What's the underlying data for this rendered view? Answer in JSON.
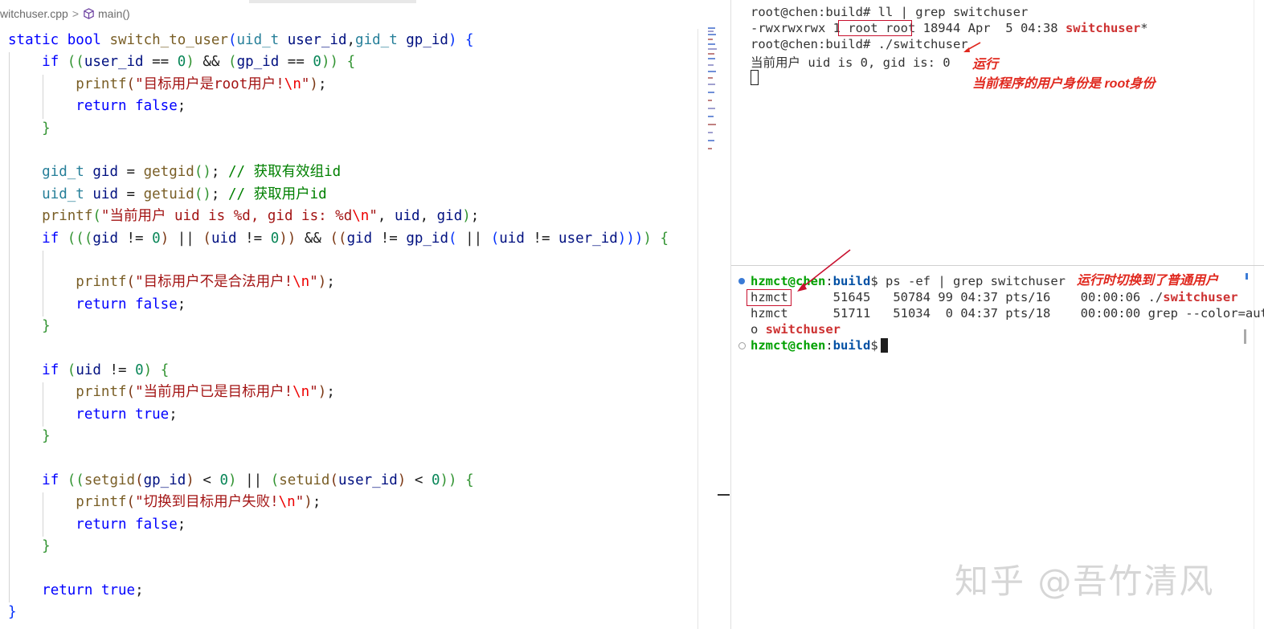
{
  "breadcrumb": {
    "file": "witchuser.cpp",
    "separator": ">",
    "symbol": "main()"
  },
  "code_lines": [
    [
      [
        "kw",
        "static "
      ],
      [
        "kw",
        "bool "
      ],
      [
        "fn",
        "switch_to_user"
      ],
      [
        "bk",
        "("
      ],
      [
        "ty",
        "uid_t "
      ],
      [
        "vr",
        "user_id"
      ],
      [
        "",
        ","
      ],
      [
        "ty",
        "gid_t "
      ],
      [
        "vr",
        "gp_id"
      ],
      [
        "bk",
        ") "
      ],
      [
        "bk",
        "{"
      ]
    ],
    [
      [
        "",
        "    "
      ],
      [
        "kw",
        "if "
      ],
      [
        "bk2",
        "(("
      ],
      [
        "vr",
        "user_id"
      ],
      [
        "",
        " == "
      ],
      [
        "nm",
        "0"
      ],
      [
        "bk2",
        ")"
      ],
      [
        "",
        " && "
      ],
      [
        "bk2",
        "("
      ],
      [
        "vr",
        "gp_id"
      ],
      [
        "",
        " == "
      ],
      [
        "nm",
        "0"
      ],
      [
        "bk2",
        "))"
      ],
      [
        "",
        " "
      ],
      [
        "bk2",
        "{"
      ]
    ],
    [
      [
        "",
        "        "
      ],
      [
        "fn",
        "printf"
      ],
      [
        "bk3",
        "("
      ],
      [
        "st",
        "\"目标用户是root用户!"
      ],
      [
        "es",
        "\\n"
      ],
      [
        "st",
        "\""
      ],
      [
        "bk3",
        ")"
      ],
      [
        "",
        ";"
      ]
    ],
    [
      [
        "",
        "        "
      ],
      [
        "kw",
        "return "
      ],
      [
        "kw",
        "false"
      ],
      [
        "",
        ";"
      ]
    ],
    [
      [
        "",
        "    "
      ],
      [
        "bk2",
        "}"
      ]
    ],
    [
      [
        "",
        ""
      ]
    ],
    [
      [
        "",
        "    "
      ],
      [
        "ty",
        "gid_t "
      ],
      [
        "vr",
        "gid"
      ],
      [
        "",
        " = "
      ],
      [
        "fn",
        "getgid"
      ],
      [
        "bk2",
        "()"
      ],
      [
        "",
        "; "
      ],
      [
        "cm",
        "// 获取有效组id"
      ]
    ],
    [
      [
        "",
        "    "
      ],
      [
        "ty",
        "uid_t "
      ],
      [
        "vr",
        "uid"
      ],
      [
        "",
        " = "
      ],
      [
        "fn",
        "getuid"
      ],
      [
        "bk2",
        "()"
      ],
      [
        "",
        "; "
      ],
      [
        "cm",
        "// 获取用户id"
      ]
    ],
    [
      [
        "",
        "    "
      ],
      [
        "fn",
        "printf"
      ],
      [
        "bk2",
        "("
      ],
      [
        "st",
        "\"当前用户 uid is %d, gid is: %d"
      ],
      [
        "es",
        "\\n"
      ],
      [
        "st",
        "\""
      ],
      [
        "",
        ", "
      ],
      [
        "vr",
        "uid"
      ],
      [
        "",
        ", "
      ],
      [
        "vr",
        "gid"
      ],
      [
        "bk2",
        ")"
      ],
      [
        "",
        ";"
      ]
    ],
    [
      [
        "",
        "    "
      ],
      [
        "kw",
        "if "
      ],
      [
        "bk2",
        "((("
      ],
      [
        "vr",
        "gid"
      ],
      [
        "",
        " != "
      ],
      [
        "nm",
        "0"
      ],
      [
        "bk3",
        ")"
      ],
      [
        "",
        " || "
      ],
      [
        "bk3",
        "("
      ],
      [
        "vr",
        "uid"
      ],
      [
        "",
        " != "
      ],
      [
        "nm",
        "0"
      ],
      [
        "bk3",
        "))"
      ],
      [
        "",
        " && "
      ],
      [
        "bk3",
        "(("
      ],
      [
        "vr",
        "gid"
      ],
      [
        "",
        " != "
      ],
      [
        "vr",
        "gp_id"
      ],
      [
        "bk",
        "("
      ],
      [
        "",
        " || "
      ],
      [
        "bk",
        "("
      ],
      [
        "vr",
        "uid"
      ],
      [
        "",
        " != "
      ],
      [
        "vr",
        "user_id"
      ],
      [
        "bk",
        ")))"
      ],
      [
        "bk2",
        ")"
      ],
      [
        "",
        " "
      ],
      [
        "bk2",
        "{"
      ]
    ],
    [
      [
        "",
        ""
      ]
    ],
    [
      [
        "",
        "        "
      ],
      [
        "fn",
        "printf"
      ],
      [
        "bk3",
        "("
      ],
      [
        "st",
        "\"目标用户不是合法用户!"
      ],
      [
        "es",
        "\\n"
      ],
      [
        "st",
        "\""
      ],
      [
        "bk3",
        ")"
      ],
      [
        "",
        ";"
      ]
    ],
    [
      [
        "",
        "        "
      ],
      [
        "kw",
        "return "
      ],
      [
        "kw",
        "false"
      ],
      [
        "",
        ";"
      ]
    ],
    [
      [
        "",
        "    "
      ],
      [
        "bk2",
        "}"
      ]
    ],
    [
      [
        "",
        ""
      ]
    ],
    [
      [
        "",
        "    "
      ],
      [
        "kw",
        "if "
      ],
      [
        "bk2",
        "("
      ],
      [
        "vr",
        "uid"
      ],
      [
        "",
        " != "
      ],
      [
        "nm",
        "0"
      ],
      [
        "bk2",
        ")"
      ],
      [
        "",
        " "
      ],
      [
        "bk2",
        "{"
      ]
    ],
    [
      [
        "",
        "        "
      ],
      [
        "fn",
        "printf"
      ],
      [
        "bk3",
        "("
      ],
      [
        "st",
        "\"当前用户已是目标用户!"
      ],
      [
        "es",
        "\\n"
      ],
      [
        "st",
        "\""
      ],
      [
        "bk3",
        ")"
      ],
      [
        "",
        ";"
      ]
    ],
    [
      [
        "",
        "        "
      ],
      [
        "kw",
        "return "
      ],
      [
        "kw",
        "true"
      ],
      [
        "",
        ";"
      ]
    ],
    [
      [
        "",
        "    "
      ],
      [
        "bk2",
        "}"
      ]
    ],
    [
      [
        "",
        ""
      ]
    ],
    [
      [
        "",
        "    "
      ],
      [
        "kw",
        "if "
      ],
      [
        "bk2",
        "(("
      ],
      [
        "fn",
        "setgid"
      ],
      [
        "bk3",
        "("
      ],
      [
        "vr",
        "gp_id"
      ],
      [
        "bk3",
        ")"
      ],
      [
        "",
        " < "
      ],
      [
        "nm",
        "0"
      ],
      [
        "bk2",
        ")"
      ],
      [
        "",
        " || "
      ],
      [
        "bk2",
        "("
      ],
      [
        "fn",
        "setuid"
      ],
      [
        "bk3",
        "("
      ],
      [
        "vr",
        "user_id"
      ],
      [
        "bk3",
        ")"
      ],
      [
        "",
        " < "
      ],
      [
        "nm",
        "0"
      ],
      [
        "bk2",
        "))"
      ],
      [
        "",
        " "
      ],
      [
        "bk2",
        "{"
      ]
    ],
    [
      [
        "",
        "        "
      ],
      [
        "fn",
        "printf"
      ],
      [
        "bk3",
        "("
      ],
      [
        "st",
        "\"切换到目标用户失败!"
      ],
      [
        "es",
        "\\n"
      ],
      [
        "st",
        "\""
      ],
      [
        "bk3",
        ")"
      ],
      [
        "",
        ";"
      ]
    ],
    [
      [
        "",
        "        "
      ],
      [
        "kw",
        "return "
      ],
      [
        "kw",
        "false"
      ],
      [
        "",
        ";"
      ]
    ],
    [
      [
        "",
        "    "
      ],
      [
        "bk2",
        "}"
      ]
    ],
    [
      [
        "",
        ""
      ]
    ],
    [
      [
        "",
        "    "
      ],
      [
        "kw",
        "return "
      ],
      [
        "kw",
        "true"
      ],
      [
        "",
        ";"
      ]
    ],
    [
      [
        "bk",
        "}"
      ]
    ]
  ],
  "terminal_top": {
    "cmd1": "root@chen:build# ll | grep switchuser",
    "ls_prefix": "-rwxrwxrwx 1",
    "ls_owner": " root root",
    "ls_rest": " 18944 Apr  5 04:38 ",
    "ls_file": "switchuser",
    "ls_suffix": "*",
    "cmd2": "root@chen:build# ./switchuser",
    "output": "当前用户 uid is 0, gid is: 0"
  },
  "annotations": {
    "run": "运行",
    "root_identity": "当前程序的用户身份是 root身份",
    "switched": "运行时切换到了普通用户"
  },
  "terminal_bottom": {
    "prompt_user": "hzmct@chen",
    "prompt_path": "build",
    "prompt_symbol": "$ ",
    "cmd": "ps -ef | grep switchuser",
    "row1_user": "hzmct",
    "row1_rest": "      51645   50784 99 04:37 pts/16    00:00:06 ./",
    "row1_hl": "switchuser",
    "row2": "hzmct      51711   51034  0 04:37 pts/18    00:00:00 grep --color=aut",
    "row3_prefix": "o ",
    "row3_hl": "switchuser",
    "prompt2_user": "hzmct@chen",
    "prompt2_path": "build",
    "prompt2_symbol": "$ "
  },
  "watermark": "知乎 @吾竹清风",
  "colors": {
    "keyword": "#0000ff",
    "type": "#267f99",
    "function": "#795e26",
    "variable": "#001080",
    "string": "#a31515",
    "comment": "#008000",
    "annotation_red": "#e0281e",
    "highlight_red": "#cd3131"
  }
}
